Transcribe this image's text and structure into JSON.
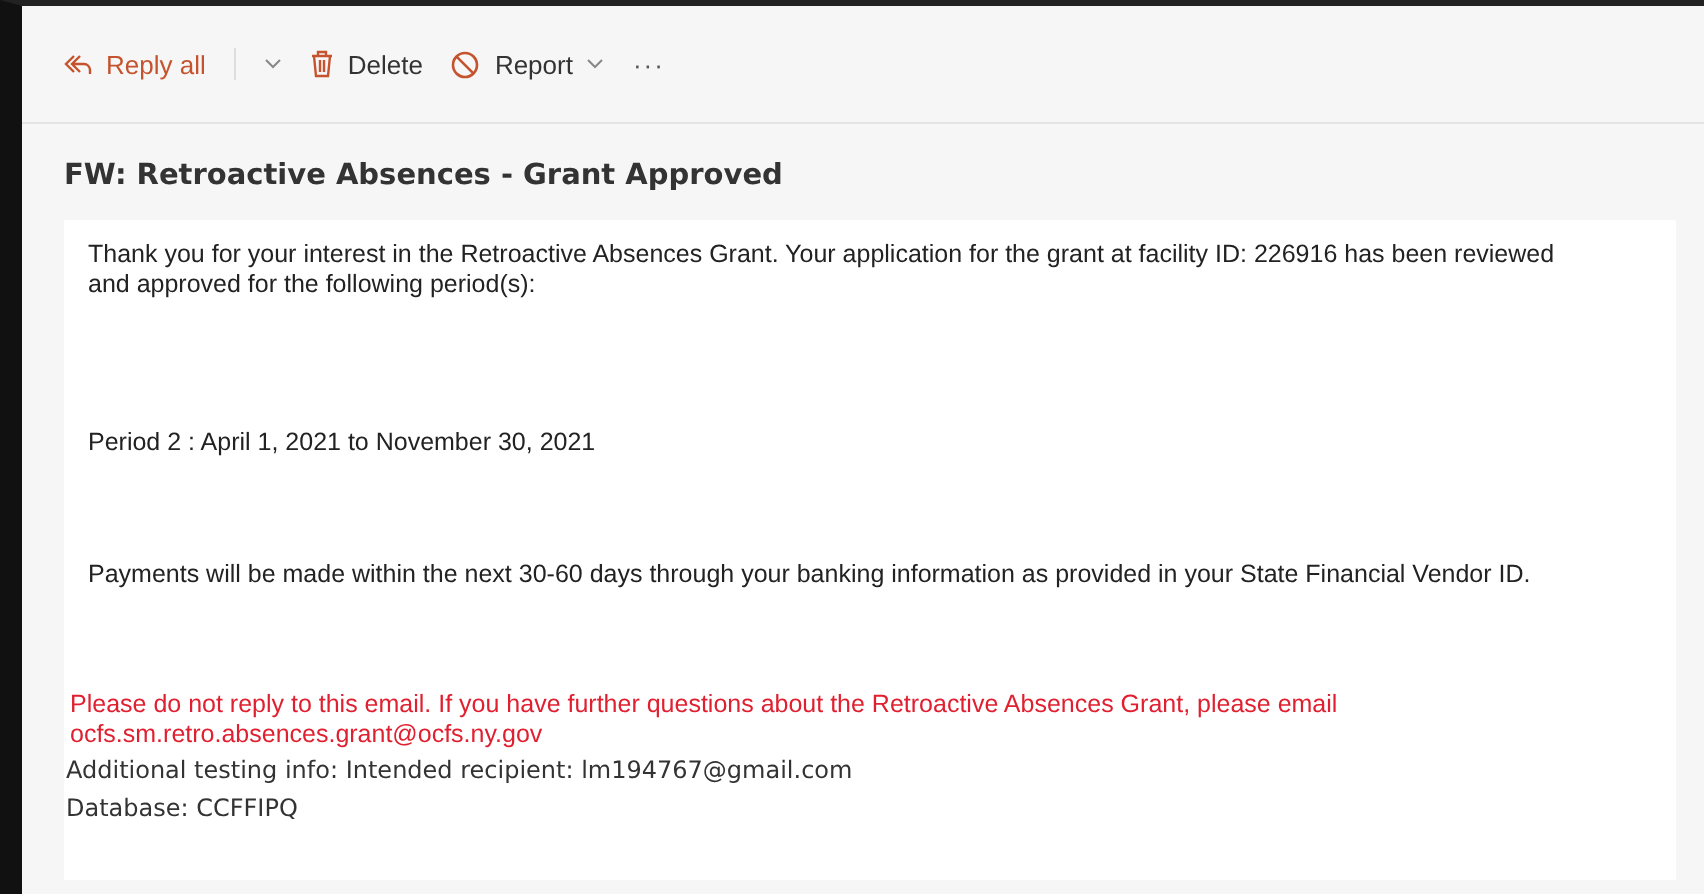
{
  "toolbar": {
    "actions": [
      {
        "kind": "reply",
        "label": "Reply all",
        "menu": true
      },
      {
        "kind": "delete",
        "label": "Delete",
        "menu": false
      },
      {
        "kind": "report",
        "label": "Report",
        "menu": true
      },
      {
        "kind": "more",
        "label": "···",
        "menu": false
      }
    ]
  },
  "message": {
    "subject": "FW: Retroactive Absences - Grant Approved",
    "paragraphs": [
      "Thank you for your interest in the Retroactive Absences Grant. Your application for the grant at facility ID: 226916 has been reviewed and approved for the following period(s):",
      "Period 2 : April 1, 2021 to November 30, 2021",
      "Payments will be made within the next 30-60 days through your banking information as provided in your State Financial Vendor ID."
    ],
    "notice": "Please do not reply to this email. If you have further questions about the Retroactive Absences Grant, please email",
    "notice_email": "ocfs.sm.retro.absences.grant@ocfs.ny.gov",
    "footer_lines": [
      "Additional testing info: Intended recipient: lm194767@gmail.com",
      "Database: CCFFIPQ"
    ]
  }
}
